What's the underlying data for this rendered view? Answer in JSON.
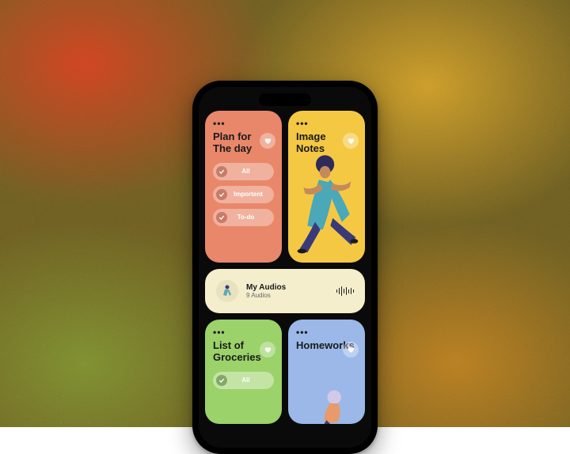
{
  "cards": {
    "plan": {
      "title": "Plan for\nThe day",
      "chips": [
        "All",
        "Importent",
        "To-do"
      ]
    },
    "image_notes": {
      "title": "Image Notes"
    },
    "audios": {
      "title": "My Audios",
      "subtitle": "9 Audios"
    },
    "groceries": {
      "title": "List of Groceries",
      "chips": [
        "All"
      ]
    },
    "homeworks": {
      "title": "Homeworks"
    }
  },
  "icons": {
    "more": "•••"
  }
}
